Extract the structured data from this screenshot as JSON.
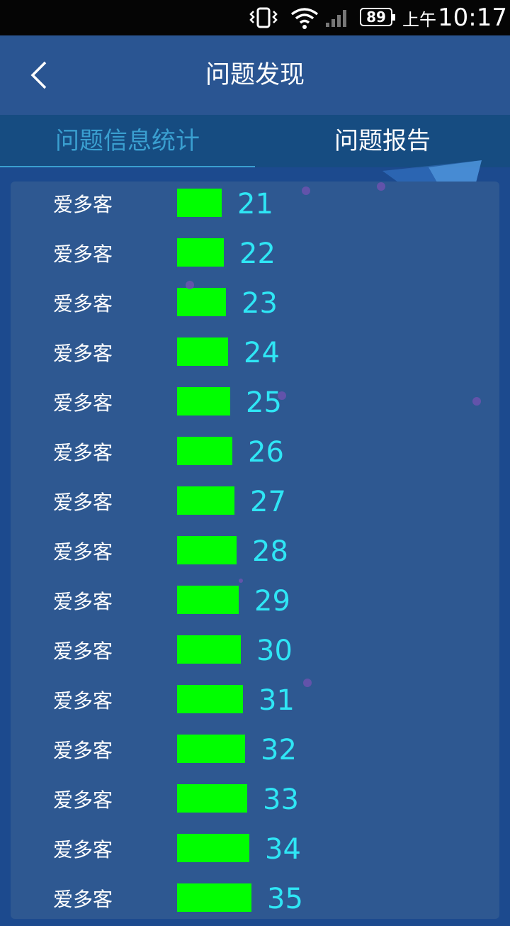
{
  "status_bar": {
    "battery": "89",
    "ampm": "上午",
    "time": "10:17"
  },
  "header": {
    "title": "问题发现"
  },
  "tabs": [
    {
      "label": "问题信息统计",
      "active": true
    },
    {
      "label": "问题报告",
      "active": false
    }
  ],
  "colors": {
    "bar": "#00ff00",
    "value_text": "#2fe6f5",
    "active_tab": "#3a9fd0"
  },
  "chart_data": {
    "type": "bar",
    "orientation": "horizontal",
    "categories": [
      "爱多客",
      "爱多客",
      "爱多客",
      "爱多客",
      "爱多客",
      "爱多客",
      "爱多客",
      "爱多客",
      "爱多客",
      "爱多客",
      "爱多客",
      "爱多客",
      "爱多客",
      "爱多客",
      "爱多客"
    ],
    "values": [
      21,
      22,
      23,
      24,
      25,
      26,
      27,
      28,
      29,
      30,
      31,
      32,
      33,
      34,
      35
    ]
  }
}
